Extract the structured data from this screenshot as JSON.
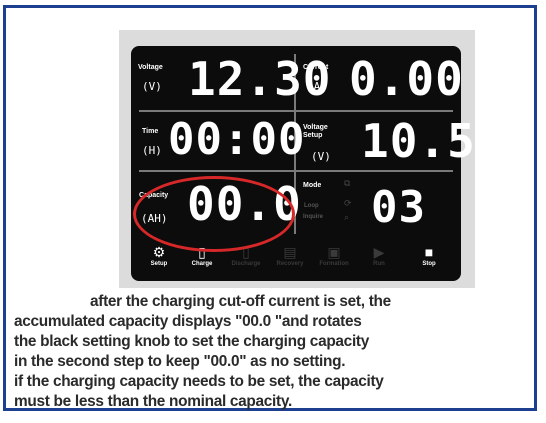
{
  "display": {
    "voltage": {
      "label": "Voltage",
      "unit": "(V)",
      "value": "12.30"
    },
    "current": {
      "label": "Current",
      "unit": "(A)",
      "value": "0.00"
    },
    "time": {
      "label": "Time",
      "unit": "(H)",
      "value": "00:00"
    },
    "voltage_setup": {
      "label_line1": "Voltage",
      "label_line2": "Setup",
      "unit": "(V)",
      "value": "10.5"
    },
    "capacity": {
      "label": "Capacity",
      "unit": "(AH)",
      "value": "00.0"
    },
    "mode": {
      "label": "Mode",
      "sub1": "Loop",
      "sub2": "Inquire",
      "value": "03"
    }
  },
  "buttons": [
    {
      "label": "Setup",
      "icon": "gear-icon",
      "active": true
    },
    {
      "label": "Charge",
      "icon": "battery-charge-icon",
      "active": true
    },
    {
      "label": "Discharge",
      "icon": "battery-discharge-icon",
      "active": false
    },
    {
      "label": "Recovery",
      "icon": "battery-recovery-icon",
      "active": false
    },
    {
      "label": "Formation",
      "icon": "battery-formation-icon",
      "active": false
    },
    {
      "label": "Run",
      "icon": "play-icon",
      "active": false
    },
    {
      "label": "Stop",
      "icon": "stop-icon",
      "active": true
    }
  ],
  "caption": {
    "line1": "after the charging cut-off current is set, the",
    "line2": "accumulated capacity displays \"00.0 \"and rotates",
    "line3": "the black setting knob to set the charging capacity",
    "line4": "in the second step to keep \"00.0\" as no setting.",
    "line5": "if the charging capacity needs to be set, the capacity",
    "line6": "must be less than the nominal capacity."
  },
  "colors": {
    "frame": "#1d3f8f",
    "highlight": "#d62828",
    "lcd_bg": "#0c0c0c"
  }
}
